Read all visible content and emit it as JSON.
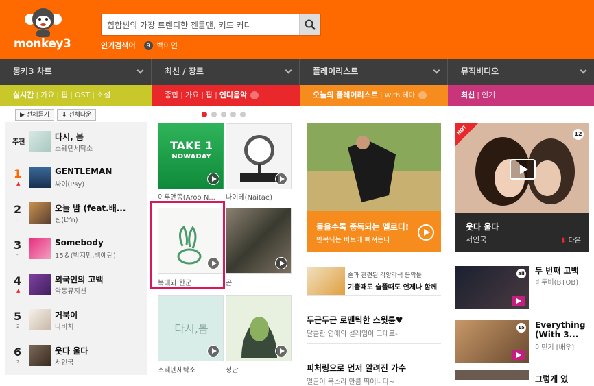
{
  "header": {
    "logo_text": "monkey3",
    "search_placeholder": "힙합씬의 가장 트렌디한 젠틀맨, 키드 커디",
    "popular_label": "인기검색어",
    "popular_num": "9",
    "popular_keyword": "백아연"
  },
  "nav": [
    {
      "label": "몽키3 차트"
    },
    {
      "label": "최신 / 장르"
    },
    {
      "label": "플레이리스트"
    },
    {
      "label": "뮤직비디오"
    }
  ],
  "sub": {
    "chart": {
      "active": "실시간",
      "items": [
        "가요",
        "팝",
        "OST",
        "소셜"
      ]
    },
    "genre": {
      "items": [
        "종합",
        "가요",
        "팝"
      ],
      "active": "인디음악"
    },
    "playlist": {
      "active": "오늘의 플레이리스트",
      "extra": "With 테마"
    },
    "mv": {
      "active": "최신",
      "extra": "인기"
    }
  },
  "tools": {
    "play_all": "전체듣기",
    "download_all": "전체다운"
  },
  "chart_list": [
    {
      "rank": "추천",
      "change": "",
      "title": "다시, 봄",
      "artist": "스웨덴세탁소"
    },
    {
      "rank": "1",
      "change": "▲",
      "title": "GENTLEMAN",
      "artist": "싸이(Psy)"
    },
    {
      "rank": "2",
      "change": "-",
      "title": "오늘 밤 (feat.배...",
      "artist": "린(LYn)"
    },
    {
      "rank": "3",
      "change": "-",
      "title": "Somebody",
      "artist": "15＆(박지민,백예린)"
    },
    {
      "rank": "4",
      "change": "▲",
      "title": "외국인의 고백",
      "artist": "악동뮤지션"
    },
    {
      "rank": "5",
      "change": "2",
      "title": "거북이",
      "artist": "다비치"
    },
    {
      "rank": "6",
      "change": "2",
      "title": "웃다 울다",
      "artist": "서인국"
    }
  ],
  "albums": [
    {
      "label": "이루앤쫑(Aroo N...",
      "cover_text": "TAKE 1",
      "cover_sub": "NOWADAY"
    },
    {
      "label": "나이테(Naitae)"
    },
    {
      "label": "복태와 한군"
    },
    {
      "label": "곤"
    },
    {
      "label": "스웨덴세탁소",
      "cover_text": "다시,봄"
    },
    {
      "label": "정단"
    }
  ],
  "playlist": {
    "banner_title": "들을수록 중독되는 멜로디!",
    "banner_sub": "반복되는 비트에 빠져든다",
    "side_text1": "술과 관련된 각양각색 음악들",
    "side_text2": "기쁠때도 슬플때도 언제나 함께",
    "items": [
      {
        "title": "두근두근 로맨틱한 스윗튠♥",
        "sub": "달콤한 연애의 설레임이 그대로-"
      },
      {
        "title": "피처링으로 먼저 알려진 가수",
        "sub": "얼굴이 목소리 만큼 뛰어나다~"
      }
    ]
  },
  "mv": {
    "main_title": "웃다 울다",
    "main_artist": "서인국",
    "download": "다운",
    "hot_badge": "HOT",
    "age": "12",
    "items": [
      {
        "title": "두 번째 고백",
        "artist": "비투비(BTOB)",
        "badge": "all"
      },
      {
        "title": "Everything (With 3...",
        "artist": "이민기 [배우]",
        "badge": "15"
      },
      {
        "title": "그렇게 였",
        "artist": ""
      }
    ]
  },
  "colors": {
    "orange": "#ff6a00",
    "chart": "#c8c82a",
    "genre": "#e8282b",
    "playlist": "#f68b1e",
    "mv": "#c8357a"
  }
}
